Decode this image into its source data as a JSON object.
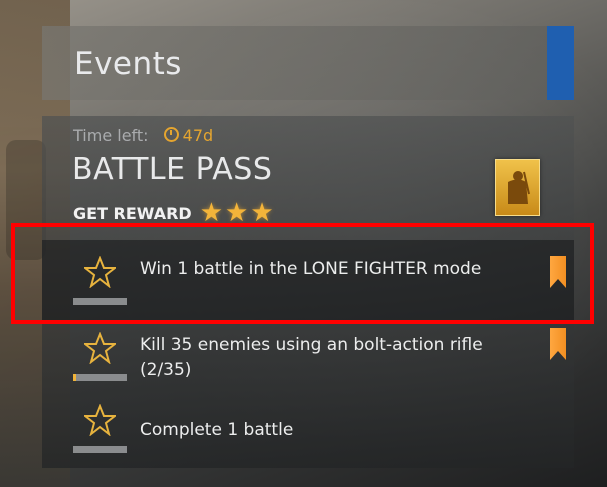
{
  "header": {
    "title": "Events"
  },
  "event": {
    "time_left_label": "Time left:",
    "time_left_value": "47d",
    "title": "BATTLE PASS",
    "reward_label": "GET REWARD",
    "reward_stars": 3
  },
  "tasks": [
    {
      "text": "Win 1 battle in the LONE FIGHTER mode",
      "progress": 0,
      "bookmarked": true
    },
    {
      "text": "Kill 35 enemies using an bolt-action rifle (2/35)",
      "progress": 0.057,
      "bookmarked": true
    },
    {
      "text": "Complete 1 battle",
      "progress": 0,
      "bookmarked": false
    }
  ],
  "colors": {
    "accent": "#1f5fb0",
    "gold": "#e7b33e",
    "highlight": "#ff0000",
    "bookmark": "#f7952a"
  }
}
